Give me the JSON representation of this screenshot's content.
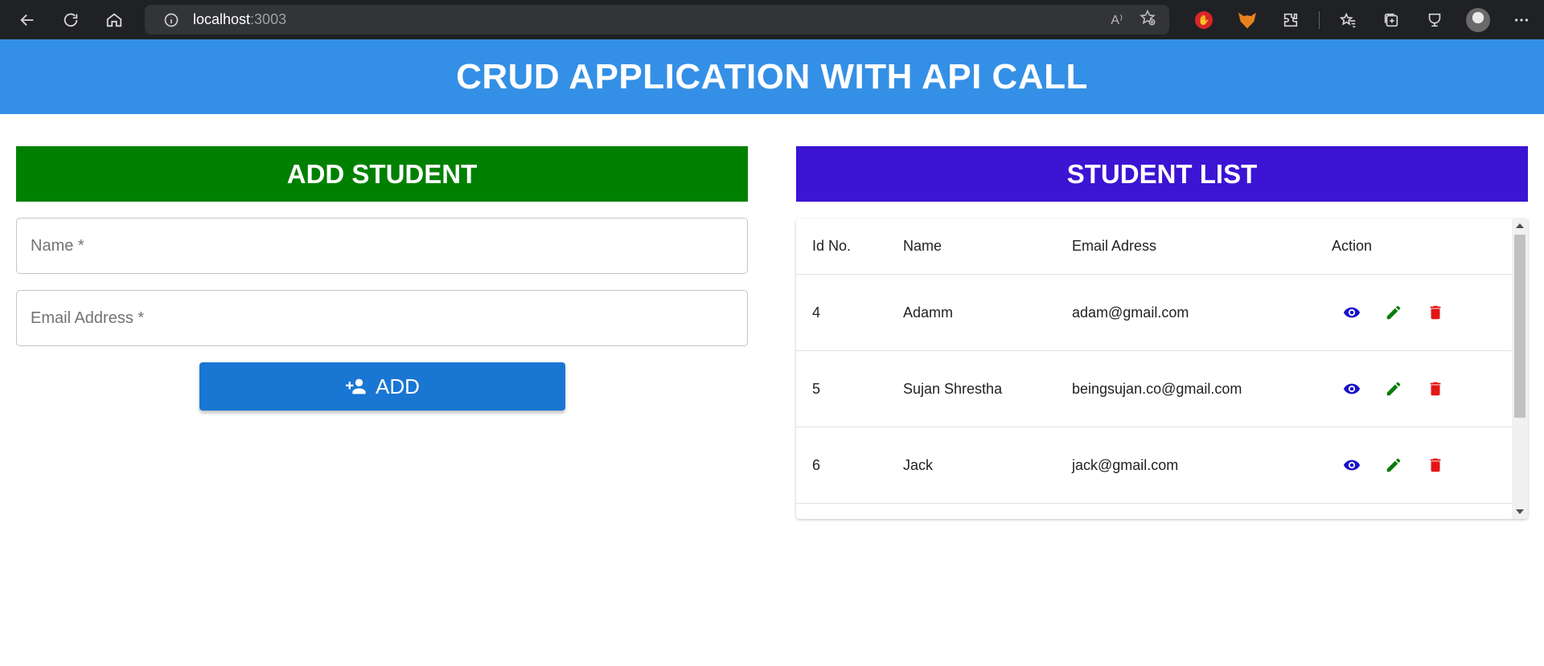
{
  "browser": {
    "url_host": "localhost",
    "url_port": ":3003",
    "read_aloud_icon": "A⁾"
  },
  "app": {
    "title": "CRUD APPLICATION WITH API CALL"
  },
  "add_student": {
    "title": "ADD STUDENT",
    "name_placeholder": "Name *",
    "email_placeholder": "Email Address *",
    "add_button_label": "ADD"
  },
  "student_list": {
    "title": "STUDENT LIST",
    "columns": [
      "Id No.",
      "Name",
      "Email Adress",
      "Action"
    ],
    "rows": [
      {
        "id": "4",
        "name": "Adamm",
        "email": "adam@gmail.com"
      },
      {
        "id": "5",
        "name": "Sujan Shrestha",
        "email": "beingsujan.co@gmail.com"
      },
      {
        "id": "6",
        "name": "Jack",
        "email": "jack@gmail.com"
      }
    ]
  },
  "colors": {
    "app_header": "#3490e6",
    "add_header": "#008000",
    "list_header": "#3b14d4",
    "add_button": "#1976d2",
    "view_icon": "#1a12c9",
    "edit_icon": "#0a7d0a",
    "delete_icon": "#e31616"
  },
  "icons": {
    "back": "back-arrow-icon",
    "refresh": "refresh-icon",
    "home": "home-icon",
    "view": "eye-icon",
    "edit": "pencil-icon",
    "delete": "trash-icon",
    "add": "person-add-icon"
  }
}
